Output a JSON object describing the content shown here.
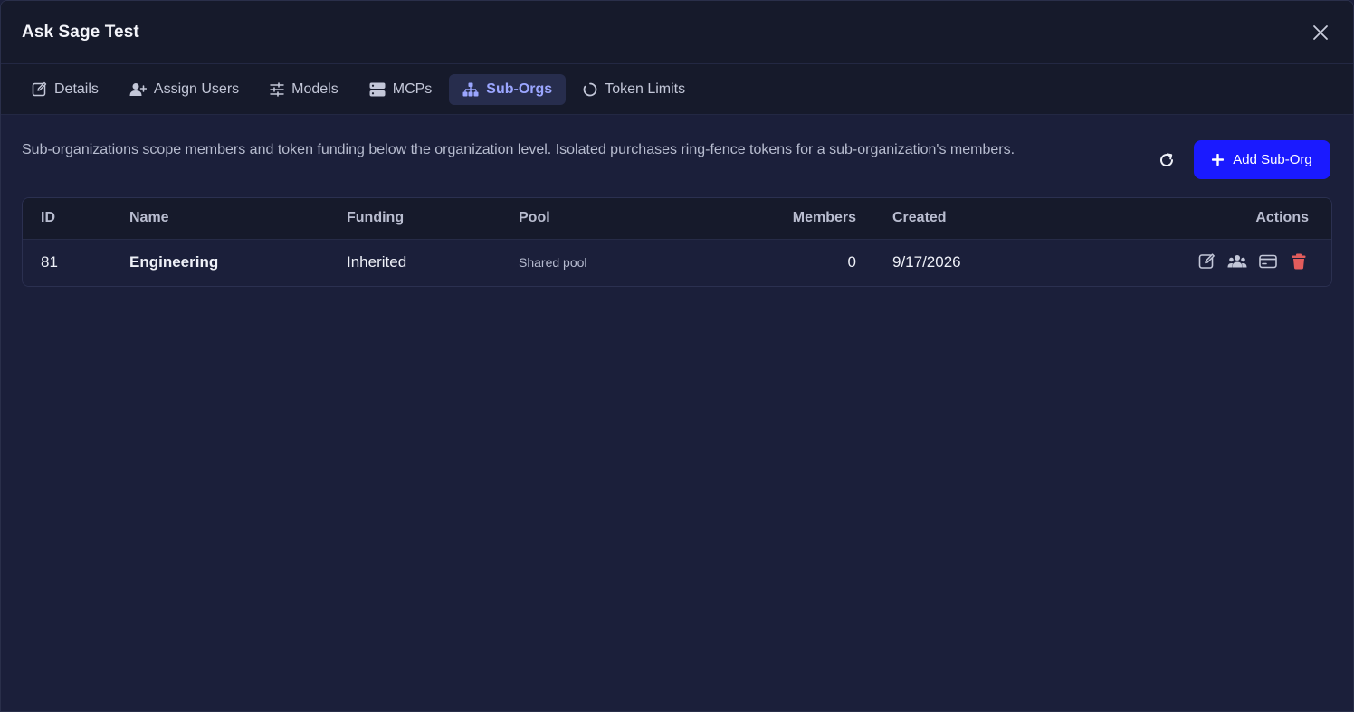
{
  "modal": {
    "title": "Ask Sage Test"
  },
  "tabs": [
    {
      "label": "Details",
      "icon": "edit-icon"
    },
    {
      "label": "Assign Users",
      "icon": "user-plus-icon"
    },
    {
      "label": "Models",
      "icon": "sliders-icon"
    },
    {
      "label": "MCPs",
      "icon": "server-icon"
    },
    {
      "label": "Sub-Orgs",
      "icon": "hierarchy-icon",
      "active": true
    },
    {
      "label": "Token Limits",
      "icon": "circle-notch-icon"
    }
  ],
  "suborgs": {
    "description": "Sub-organizations scope members and token funding below the organization level. Isolated purchases ring-fence tokens for a sub-organization's members.",
    "add_label": "Add Sub-Org",
    "columns": [
      "ID",
      "Name",
      "Funding",
      "Pool",
      "Members",
      "Created",
      "Actions"
    ],
    "rows": [
      {
        "id": "81",
        "name": "Engineering",
        "funding": "Inherited",
        "pool": "Shared pool",
        "members": "0",
        "created": "9/17/2026"
      }
    ]
  },
  "colors": {
    "accent": "#1a1aff",
    "active_tab_text": "#9ba6ff",
    "danger": "#e25c5c",
    "background": "#1b1f3a",
    "header_bg": "#161a2b"
  }
}
